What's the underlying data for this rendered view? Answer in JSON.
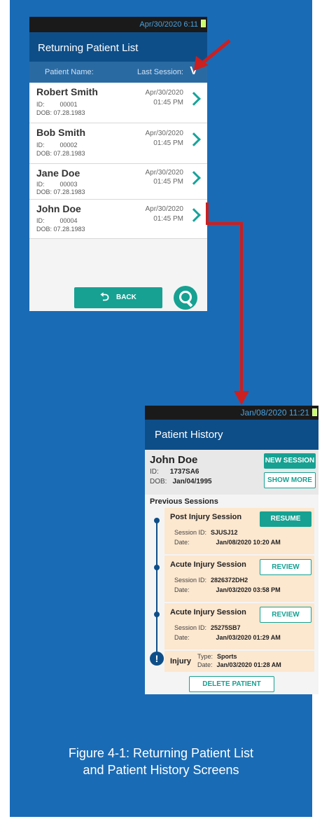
{
  "colors": {
    "panel": "#1a6bb5",
    "appbar": "#0e4e88",
    "accent": "#16a192",
    "arrow": "#cc1f1f",
    "session_bg": "#fce7cf"
  },
  "list_screen": {
    "status_time": "Apr/30/2020 6:11",
    "title": "Returning Patient List",
    "col_name": "Patient Name:",
    "col_session": "Last Session:",
    "sort_icon": "chevron-down-icon",
    "patients": [
      {
        "name": "Robert Smith",
        "id_label": "ID:",
        "id": "00001",
        "dob": "DOB: 07.28.1983",
        "date": "Apr/30/2020",
        "time": "01:45 PM"
      },
      {
        "name": "Bob Smith",
        "id_label": "ID:",
        "id": "00002",
        "dob": "DOB: 07.28.1983",
        "date": "Apr/30/2020",
        "time": "01:45 PM"
      },
      {
        "name": "Jane Doe",
        "id_label": "ID:",
        "id": "00003",
        "dob": "DOB: 07.28.1983",
        "date": "Apr/30/2020",
        "time": "01:45 PM"
      },
      {
        "name": "John Doe",
        "id_label": "ID:",
        "id": "00004",
        "dob": "DOB: 07.28.1983",
        "date": "Apr/30/2020",
        "time": "01:45 PM"
      }
    ],
    "back_label": "BACK"
  },
  "history_screen": {
    "status_time": "Jan/08/2020 11:21",
    "title": "Patient History",
    "patient_name": "John Doe",
    "id_label": "ID:",
    "id_value": "1737SA6",
    "dob_label": "DOB:",
    "dob_value": "Jan/04/1995",
    "new_session": "NEW SESSION",
    "show_more": "SHOW MORE",
    "previous_sessions": "Previous Sessions",
    "sessions": [
      {
        "title": "Post Injury Session",
        "button": "RESUME",
        "sid_label": "Session ID:",
        "sid": "SJUSJ12",
        "date_label": "Date:",
        "date": "Jan/08/2020 10:20 AM"
      },
      {
        "title": "Acute Injury Session",
        "button": "REVIEW",
        "sid_label": "Session ID:",
        "sid": "2826372DH2",
        "date_label": "Date:",
        "date": "Jan/03/2020 03:58 PM"
      },
      {
        "title": "Acute Injury Session",
        "button": "REVIEW",
        "sid_label": "Session ID:",
        "sid": "25275SB7",
        "date_label": "Date:",
        "date": "Jan/03/2020 01:29 AM"
      }
    ],
    "injury": {
      "label": "Injury",
      "type_label": "Type:",
      "type": "Sports",
      "date_label": "Date:",
      "date": "Jan/03/2020 01:28 AM"
    },
    "delete_label": "DELETE PATIENT"
  },
  "caption": {
    "line1": "Figure 4-1: Returning Patient List",
    "line2": "and Patient History Screens"
  }
}
